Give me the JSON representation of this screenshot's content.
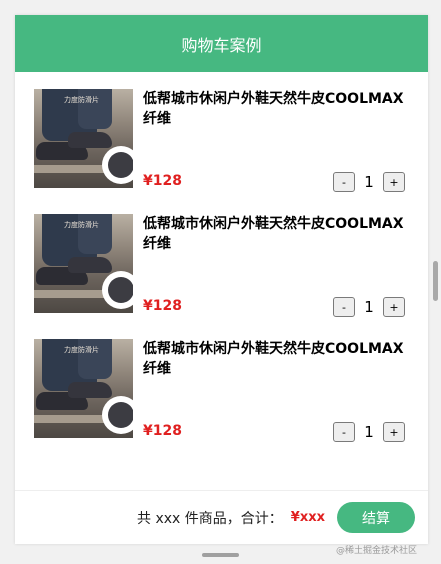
{
  "colors": {
    "header_bg": "#46b881",
    "price": "#e02020",
    "checkout_bg": "#46b881"
  },
  "header": {
    "title": "购物车案例"
  },
  "items": [
    {
      "image_caption": "力度防滑片",
      "name": "低帮城市休闲户外鞋天然牛皮COOLMAX纤维",
      "price": "¥128",
      "quantity": "1",
      "minus_label": "-",
      "plus_label": "+"
    },
    {
      "image_caption": "力度防滑片",
      "name": "低帮城市休闲户外鞋天然牛皮COOLMAX纤维",
      "price": "¥128",
      "quantity": "1",
      "minus_label": "-",
      "plus_label": "+"
    },
    {
      "image_caption": "力度防滑片",
      "name": "低帮城市休闲户外鞋天然牛皮COOLMAX纤维",
      "price": "¥128",
      "quantity": "1",
      "minus_label": "-",
      "plus_label": "+"
    }
  ],
  "footer": {
    "summary": "共 xxx 件商品，合计：",
    "total": "¥xxx",
    "checkout_label": "结算"
  },
  "watermark": "@稀土掘金技术社区"
}
